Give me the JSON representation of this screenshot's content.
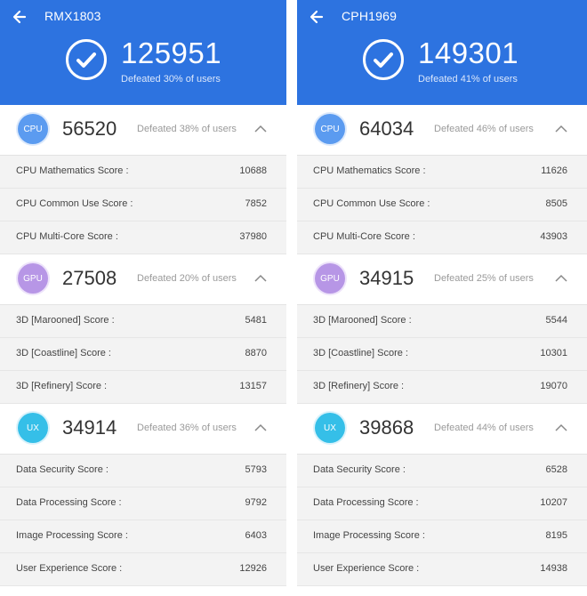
{
  "panels": [
    {
      "device": "RMX1803",
      "total": "125951",
      "total_defeated": "Defeated 30% of users",
      "cpu": {
        "badge": "CPU",
        "score": "56520",
        "defeated": "Defeated 38% of users",
        "rows": [
          {
            "label": "CPU Mathematics Score :",
            "value": "10688"
          },
          {
            "label": "CPU Common Use Score :",
            "value": "7852"
          },
          {
            "label": "CPU Multi-Core Score :",
            "value": "37980"
          }
        ]
      },
      "gpu": {
        "badge": "GPU",
        "score": "27508",
        "defeated": "Defeated 20% of users",
        "rows": [
          {
            "label": "3D [Marooned] Score :",
            "value": "5481"
          },
          {
            "label": "3D [Coastline] Score :",
            "value": "8870"
          },
          {
            "label": "3D [Refinery] Score :",
            "value": "13157"
          }
        ]
      },
      "ux": {
        "badge": "UX",
        "score": "34914",
        "defeated": "Defeated 36% of users",
        "rows": [
          {
            "label": "Data Security Score :",
            "value": "5793"
          },
          {
            "label": "Data Processing Score :",
            "value": "9792"
          },
          {
            "label": "Image Processing Score :",
            "value": "6403"
          },
          {
            "label": "User Experience Score :",
            "value": "12926"
          }
        ]
      }
    },
    {
      "device": "CPH1969",
      "total": "149301",
      "total_defeated": "Defeated 41% of users",
      "cpu": {
        "badge": "CPU",
        "score": "64034",
        "defeated": "Defeated 46% of users",
        "rows": [
          {
            "label": "CPU Mathematics Score :",
            "value": "11626"
          },
          {
            "label": "CPU Common Use Score :",
            "value": "8505"
          },
          {
            "label": "CPU Multi-Core Score :",
            "value": "43903"
          }
        ]
      },
      "gpu": {
        "badge": "GPU",
        "score": "34915",
        "defeated": "Defeated 25% of users",
        "rows": [
          {
            "label": "3D [Marooned] Score :",
            "value": "5544"
          },
          {
            "label": "3D [Coastline] Score :",
            "value": "10301"
          },
          {
            "label": "3D [Refinery] Score :",
            "value": "19070"
          }
        ]
      },
      "ux": {
        "badge": "UX",
        "score": "39868",
        "defeated": "Defeated 44% of users",
        "rows": [
          {
            "label": "Data Security Score :",
            "value": "6528"
          },
          {
            "label": "Data Processing Score :",
            "value": "10207"
          },
          {
            "label": "Image Processing Score :",
            "value": "8195"
          },
          {
            "label": "User Experience Score :",
            "value": "14938"
          }
        ]
      }
    }
  ],
  "icons": {
    "back": "arrow-left-icon",
    "check": "check-circle-icon",
    "collapse": "chevron-up-icon"
  },
  "colors": {
    "header": "#2d73e0",
    "cpu": "#5b9bf0",
    "gpu": "#b796e6",
    "ux": "#35bfe8"
  }
}
